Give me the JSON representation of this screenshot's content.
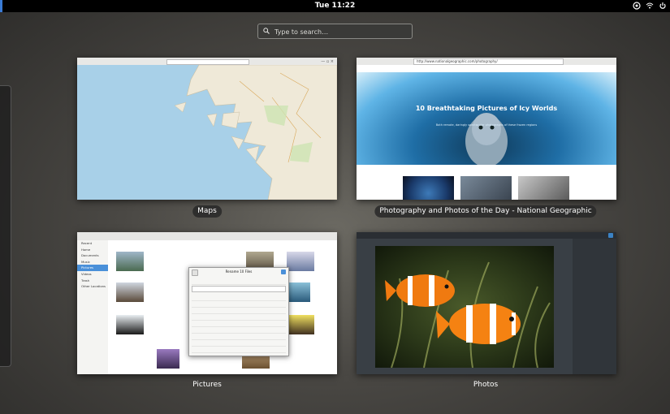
{
  "topbar": {
    "clock": "Tue 11:22"
  },
  "search": {
    "placeholder": "Type to search…"
  },
  "windows": {
    "maps": {
      "label": "Maps"
    },
    "browser": {
      "label": "Photography and Photos of the Day - National Geographic",
      "url": "http://www.nationalgeographic.com/photography/",
      "headline": "10 Breathtaking Pictures of Icy Worlds",
      "subhead": "Both remote, daringly spectacular photographs of these frozen regions"
    },
    "files": {
      "label": "Pictures",
      "sidebar": [
        "Recent",
        "Home",
        "Documents",
        "Music",
        "Pictures",
        "Videos",
        "Trash",
        "Other Locations"
      ],
      "dialog_title": "Rename 10 Files"
    },
    "photos": {
      "label": "Photos"
    }
  },
  "colors": {
    "accent": "#4a90d9",
    "topbar": "#000000"
  }
}
